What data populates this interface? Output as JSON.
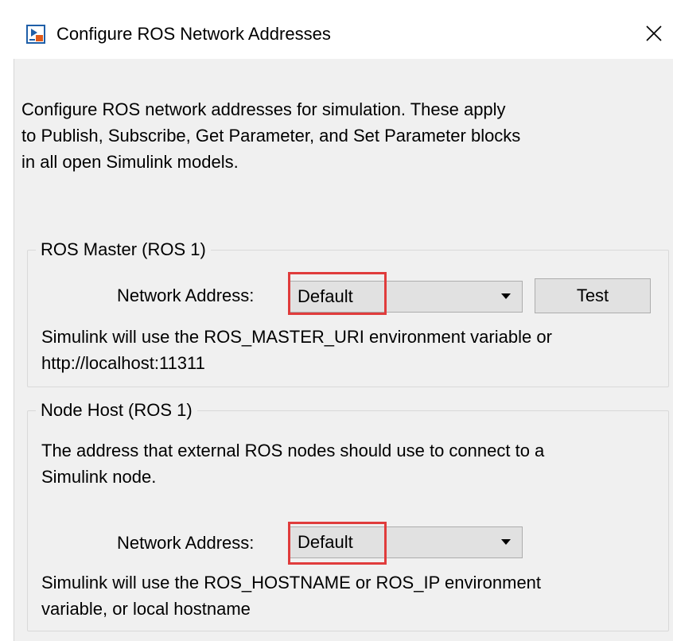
{
  "window": {
    "title": "Configure ROS Network Addresses",
    "close_glyph": "✕"
  },
  "intro": {
    "lines": [
      "Configure ROS network addresses for simulation. These apply",
      "to Publish, Subscribe, Get Parameter, and Set Parameter blocks",
      "in all open Simulink models."
    ]
  },
  "ros_master": {
    "legend": "ROS Master (ROS 1)",
    "field_label": "Network Address:",
    "selected_value": "Default",
    "test_button_label": "Test",
    "description_lines": [
      "Simulink will use the ROS_MASTER_URI environment variable or",
      "http://localhost:11311"
    ]
  },
  "node_host": {
    "legend": "Node Host (ROS 1)",
    "intro_lines": [
      "The address that external ROS nodes should use to connect to a",
      "Simulink node."
    ],
    "field_label": "Network Address:",
    "selected_value": "Default",
    "description_lines": [
      "Simulink will use the ROS_HOSTNAME or ROS_IP environment",
      "variable, or local hostname"
    ]
  },
  "colors": {
    "highlight": "#e03c3c",
    "panel_background": "#f0f0f0",
    "control_background": "#e1e1e1"
  },
  "icons": {
    "app": "simulink-app-icon",
    "close": "close-icon",
    "dropdown": "chevron-down-icon"
  }
}
